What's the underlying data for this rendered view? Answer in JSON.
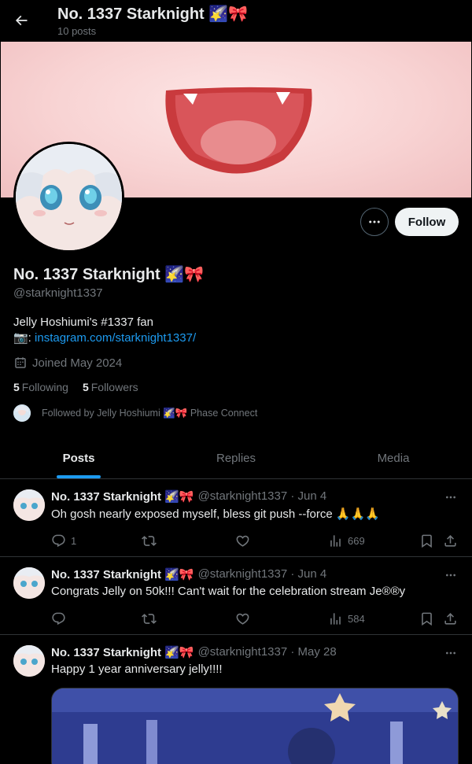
{
  "header": {
    "title": "No. 1337 Starknight 🌠🎀",
    "post_count": "10 posts"
  },
  "profile": {
    "display_name": "No. 1337 Starknight 🌠🎀",
    "handle": "@starknight1337",
    "bio_line1": "Jelly Hoshiumi's #1337 fan",
    "bio_prefix": "📷: ",
    "bio_link": "instagram.com/starknight1337/",
    "joined": "Joined May 2024",
    "following_count": "5",
    "following_label": "Following",
    "followers_count": "5",
    "followers_label": "Followers",
    "followed_by": "Followed by Jelly Hoshiumi 🌠🎀 Phase Connect",
    "follow_label": "Follow"
  },
  "tabs": [
    {
      "label": "Posts",
      "active": true
    },
    {
      "label": "Replies",
      "active": false
    },
    {
      "label": "Media",
      "active": false
    }
  ],
  "posts": [
    {
      "name": "No. 1337 Starknight 🌠🎀",
      "meta": "@starknight1337 · Jun 4",
      "text": "Oh gosh nearly exposed myself, bless git push --force 🙏🙏🙏",
      "replies": "1",
      "reposts": "",
      "likes": "",
      "views": "669"
    },
    {
      "name": "No. 1337 Starknight 🌠🎀",
      "meta": "@starknight1337 · Jun 4",
      "text": "Congrats Jelly on 50k!!! Can't wait for the celebration stream Je®®y",
      "replies": "",
      "reposts": "",
      "likes": "",
      "views": "584"
    },
    {
      "name": "No. 1337 Starknight 🌠🎀",
      "meta": "@starknight1337 · May 28",
      "text": "Happy 1 year anniversary jelly!!!!"
    }
  ],
  "icons": {
    "back": "arrow-left-icon",
    "more": "ellipsis-icon",
    "calendar": "calendar-icon",
    "reply": "reply-icon",
    "repost": "repost-icon",
    "like": "heart-icon",
    "views": "views-icon",
    "bookmark": "bookmark-icon",
    "share": "share-icon"
  },
  "colors": {
    "accent": "#1d9bf0",
    "background": "#000000",
    "text": "#e7e9ea",
    "muted": "#71767b",
    "border": "#2f3336"
  }
}
